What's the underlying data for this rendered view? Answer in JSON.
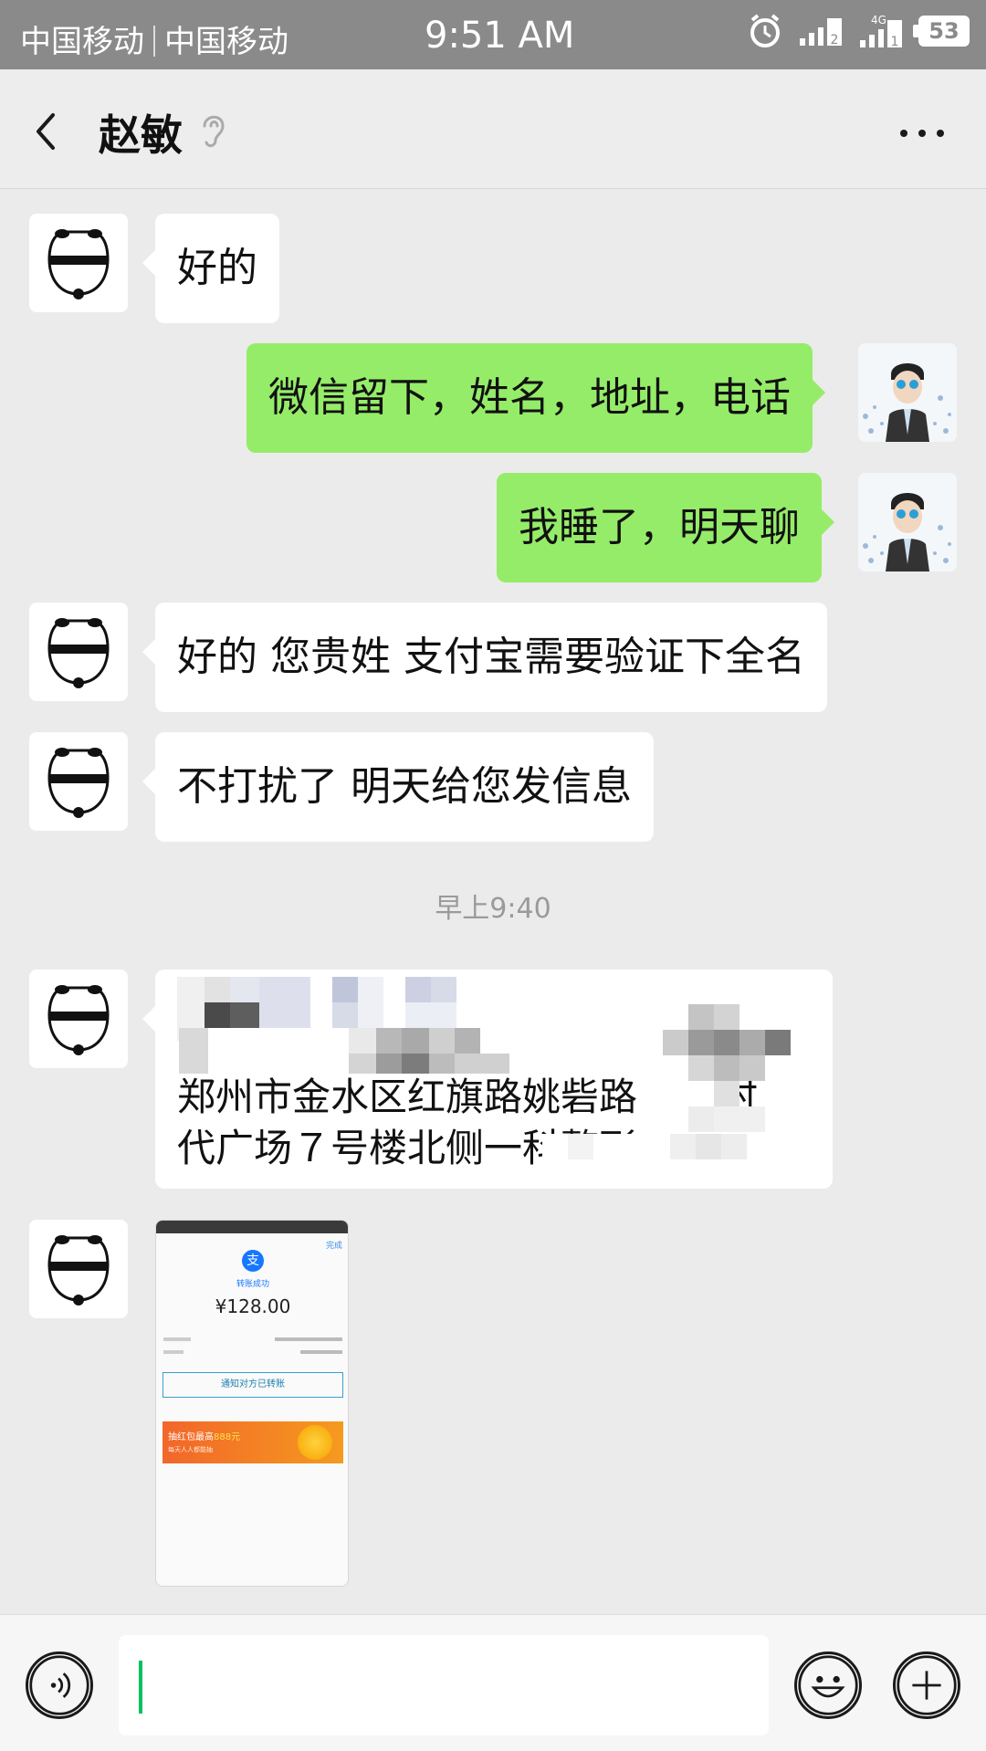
{
  "status_bar": {
    "carrier_1": "中国移动",
    "carrier_2": "中国移动",
    "time": "9:51 AM",
    "network_label": "4G",
    "sim_1": "2",
    "sim_2": "1",
    "battery": "53"
  },
  "header": {
    "contact_name": "赵敏",
    "icons": [
      "back-arrow-icon",
      "ear-icon",
      "more-icon"
    ]
  },
  "messages": [
    {
      "side": "in",
      "text": "好的"
    },
    {
      "side": "out",
      "text": "微信留下，姓名，地址，电话"
    },
    {
      "side": "out",
      "text": "我睡了，明天聊"
    },
    {
      "side": "in",
      "text": "好的 您贵姓 支付宝需要验证下全名"
    },
    {
      "side": "in",
      "text": "不打扰了 明天给您发信息"
    },
    {
      "side": "in",
      "address_line_1": "郑州市金水区红旗路姚砦路",
      "address_line_2": "时",
      "address_line_3": "代广场７号楼北侧一科整形"
    },
    {
      "side": "in",
      "type": "image"
    }
  ],
  "timestamp": "早上9:40",
  "screenshot": {
    "done": "完成",
    "status": "转账成功",
    "amount": "¥128.00",
    "notify_button": "通知对方已转账",
    "promo_title_prefix": "抽红包最高",
    "promo_amount": "888元",
    "promo_sub": "每天人人都能抽",
    "alipay_glyph": "支"
  },
  "input_bar": {
    "input_value": "",
    "icons": [
      "voice-icon",
      "emoji-icon",
      "plus-icon"
    ]
  },
  "colors": {
    "status_bar": "#8a8a8a",
    "chat_bg": "#ebebeb",
    "outgoing_bubble": "#95ec69",
    "incoming_bubble": "#ffffff",
    "caret": "#07c160"
  }
}
